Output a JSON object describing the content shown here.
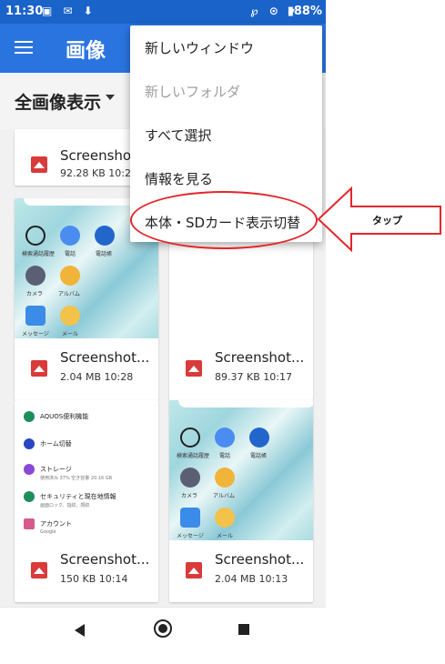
{
  "status_bar": {
    "time": "11:30",
    "left_icons": "▣ ✉ ⬇",
    "right_icons": "℘ ⊙ ▾",
    "battery": "▮88%"
  },
  "app_bar": {
    "title": "画像"
  },
  "toolbar": {
    "filter_label": "全画像表示"
  },
  "files": [
    {
      "name": "Screenshot_20190...",
      "meta": "92.28 KB 10:29"
    },
    {
      "name": "Screenshot...",
      "meta": "2.04 MB 10:28"
    },
    {
      "name": "Screenshot...",
      "meta": "89.37 KB 10:17"
    },
    {
      "name": "Screenshot...",
      "meta": "150 KB 10:14"
    },
    {
      "name": "Screenshot...",
      "meta": "2.04 MB 10:13"
    }
  ],
  "thumb_home": {
    "apps": [
      {
        "label": "検索通話履歴",
        "color": "#1f1f1f"
      },
      {
        "label": "電話",
        "color": "#4a8cf0"
      },
      {
        "label": "電話帳",
        "color": "#2266cc"
      },
      {
        "label": "カメラ",
        "color": "#5a5f73"
      },
      {
        "label": "アルバム",
        "color": "#f0b43a"
      },
      {
        "label": "メッセージ",
        "color": "#3b8be8"
      },
      {
        "label": "メール",
        "color": "#f3c24a"
      }
    ]
  },
  "thumb_settings": {
    "rows": [
      {
        "label": "AQUOS便利機能",
        "color": "#1e8e5a"
      },
      {
        "label": "ホーム切替",
        "color": "#2a47c2"
      },
      {
        "label": "ストレージ",
        "color": "#8a48d8"
      },
      {
        "label": "セキュリティと現在地情報",
        "color": "#1e8e5a"
      },
      {
        "label": "アカウント",
        "color": "#d55b8f"
      }
    ],
    "sub_storage": "使用済み 37% 空き容量 20.16 GB",
    "sub_security": "画面ロック、指紋、顔紋",
    "sub_account": "Google"
  },
  "menu": {
    "items": [
      {
        "label": "新しいウィンドウ",
        "disabled": false
      },
      {
        "label": "新しいフォルダ",
        "disabled": true
      },
      {
        "label": "すべて選択",
        "disabled": false
      },
      {
        "label": "情報を見る",
        "disabled": false
      },
      {
        "label": "本体・SDカード表示切替",
        "disabled": false
      }
    ]
  },
  "callout": {
    "label": "タップ"
  },
  "colors": {
    "appbar": "#2a74e0",
    "statusbar": "#1a63c9",
    "highlight": "#e3262a",
    "file_icon": "#d93a3a"
  }
}
